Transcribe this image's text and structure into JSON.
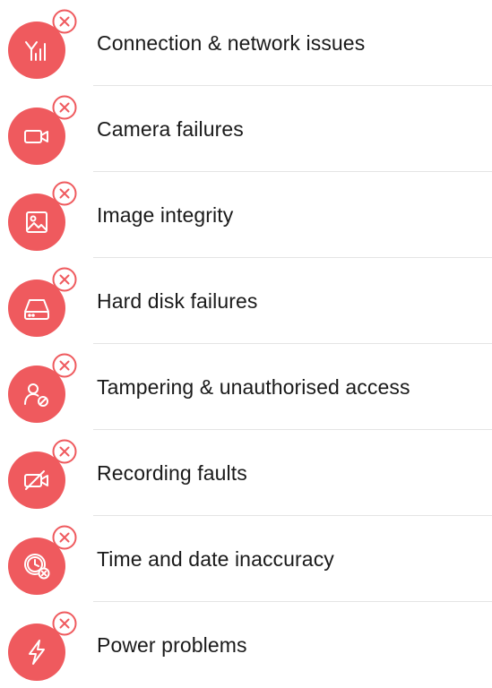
{
  "accent_color": "#ef5a5e",
  "issues": [
    {
      "label": "Connection & network issues",
      "icon": "signal-icon"
    },
    {
      "label": "Camera failures",
      "icon": "camera-icon"
    },
    {
      "label": "Image integrity",
      "icon": "image-icon"
    },
    {
      "label": "Hard disk failures",
      "icon": "hard-disk-icon"
    },
    {
      "label": "Tampering & unauthorised access",
      "icon": "user-blocked-icon"
    },
    {
      "label": "Recording faults",
      "icon": "camera-off-icon"
    },
    {
      "label": "Time and date inaccuracy",
      "icon": "clock-error-icon"
    },
    {
      "label": "Power problems",
      "icon": "lightning-icon"
    }
  ]
}
